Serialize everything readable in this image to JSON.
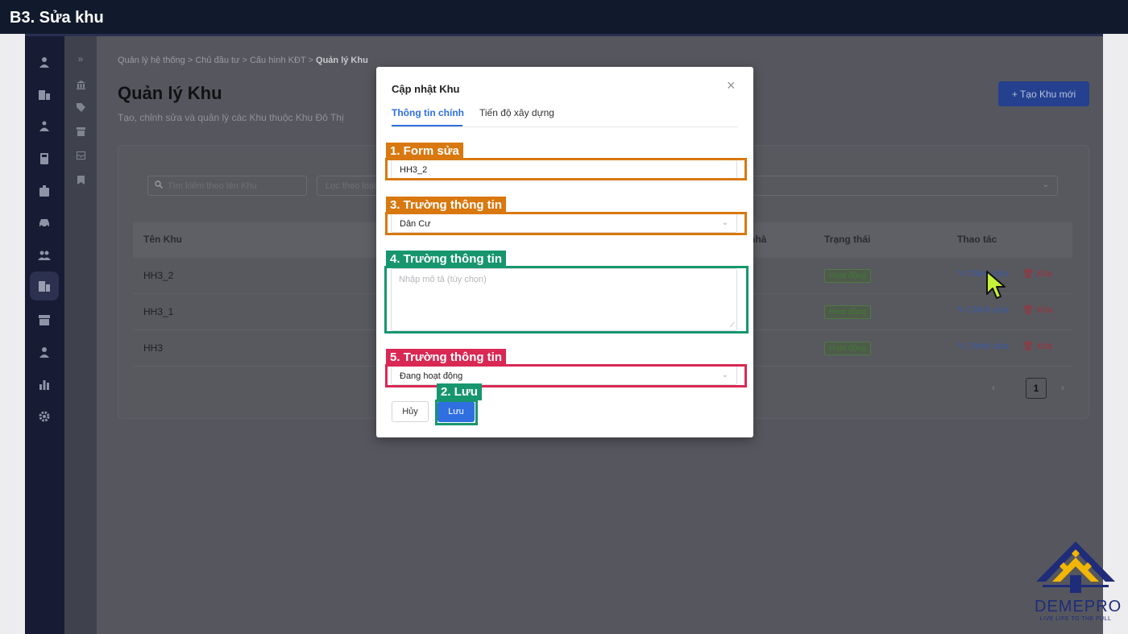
{
  "step_title": "B3. Sửa khu",
  "breadcrumb": [
    "Quản lý hệ thống",
    "Chủ đầu tư",
    "Cấu hình KĐT",
    "Quản lý Khu"
  ],
  "page": {
    "title": "Quản lý Khu",
    "subtitle": "Tạo, chỉnh sửa và quản lý các Khu thuộc Khu Đô Thị",
    "create_button": "+ Tạo Khu mới"
  },
  "toolbar": {
    "search_placeholder": "Tìm kiếm theo tên Khu",
    "filter_placeholder": "Lọc theo loại"
  },
  "table": {
    "headers": {
      "name": "Tên Khu",
      "house": "nhà",
      "status": "Trạng thái",
      "actions": "Thao tác"
    },
    "rows": [
      {
        "name": "HH3_2",
        "status": "Hoạt động"
      },
      {
        "name": "HH3_1",
        "status": "Hoạt động"
      },
      {
        "name": "HH3",
        "status": "Hoạt động"
      }
    ],
    "edit_label": "Chỉnh sửa",
    "delete_label": "Xóa"
  },
  "pagination": {
    "current_page": "1",
    "prev": "‹",
    "next": "›"
  },
  "modal": {
    "title": "Cập nhật Khu",
    "close": "×",
    "tabs": [
      "Thông tin chính",
      "Tiến độ xây dựng"
    ],
    "name_value": "HH3_2",
    "type_value": "Dân Cư",
    "description_placeholder": "Nhập mô tả (tùy chọn)",
    "status_value": "Đang hoạt động",
    "cancel_label": "Hủy",
    "save_label": "Lưu"
  },
  "annotations": {
    "form": "1. Form sửa",
    "save": "2. Lưu",
    "field3": "3. Trường thông tin",
    "field4": "4. Trường thông tin",
    "field5": "5. Trường thông tin"
  },
  "logo": {
    "brand": "DEMEPRO",
    "tagline": "LIVE LIFE TO THE FULL"
  },
  "icons": {
    "rail": [
      "user-icon",
      "building-icon",
      "handshake-icon",
      "calculator-icon",
      "luggage-icon",
      "car-icon",
      "users-icon",
      "apartment-icon",
      "store-icon",
      "person-icon",
      "chart-icon",
      "gear-icon"
    ],
    "sub": [
      "expand-icon",
      "bank-icon",
      "tag-icon",
      "shop-icon",
      "inbox-icon",
      "bookmark-icon"
    ]
  },
  "colors": {
    "accent": "#2f6fe0",
    "annotation_orange": "#d9780f",
    "annotation_green": "#17966e",
    "annotation_red": "#d92854",
    "topbar": "#111a2c"
  }
}
